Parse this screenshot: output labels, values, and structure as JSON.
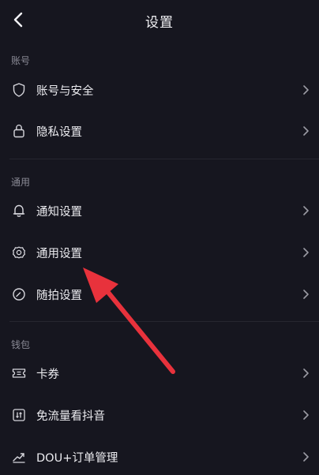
{
  "header": {
    "title": "设置",
    "back_icon": "chevron-left-icon"
  },
  "sections": [
    {
      "label": "账号",
      "items": [
        {
          "label": "账号与安全",
          "icon": "shield-icon"
        },
        {
          "label": "隐私设置",
          "icon": "lock-icon"
        }
      ]
    },
    {
      "label": "通用",
      "items": [
        {
          "label": "通知设置",
          "icon": "bell-icon"
        },
        {
          "label": "通用设置",
          "icon": "gear-icon"
        },
        {
          "label": "随拍设置",
          "icon": "camera-circle-icon"
        }
      ]
    },
    {
      "label": "钱包",
      "items": [
        {
          "label": "卡券",
          "icon": "ticket-icon"
        },
        {
          "label": "免流量看抖音",
          "icon": "data-card-icon"
        },
        {
          "label": "DOU+订单管理",
          "icon": "chart-icon"
        }
      ]
    }
  ],
  "annotation": {
    "type": "arrow",
    "color": "#e8323c"
  },
  "colors": {
    "background": "#16161f",
    "text": "#ececf0",
    "section_label": "#8a8a95",
    "icon": "#d7d7dd",
    "chevron": "#9a9aa3"
  }
}
